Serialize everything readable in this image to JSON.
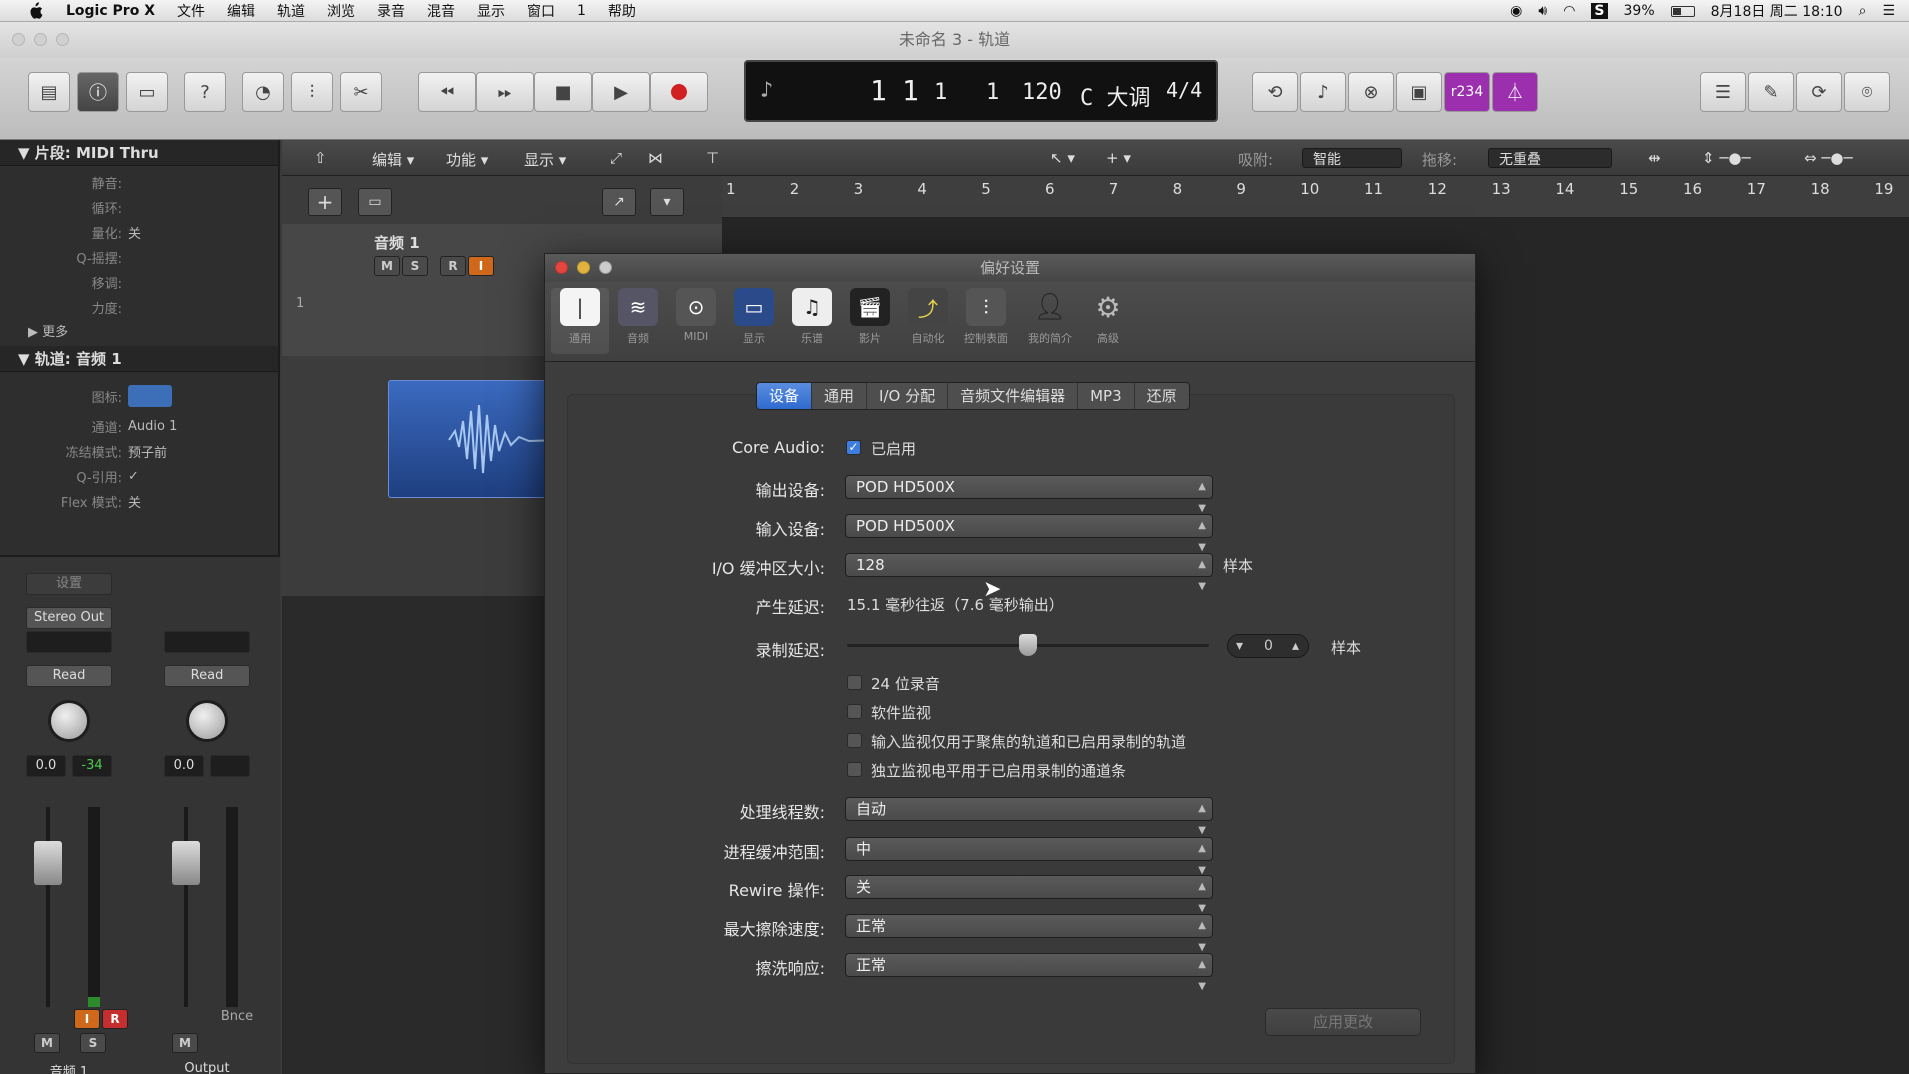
{
  "menubar": {
    "app_name": "Logic Pro X",
    "items": [
      "文件",
      "编辑",
      "轨道",
      "浏览",
      "录音",
      "混音",
      "显示",
      "窗口",
      "1",
      "帮助"
    ],
    "battery": "39%",
    "datetime": "8月18日 周二  18:10"
  },
  "window": {
    "title": "未命名 3 - 轨道"
  },
  "lcd": {
    "bar": "1",
    "beat": "1",
    "div": "1",
    "tick": "1",
    "tempo": "120",
    "key": "C 大调",
    "sig": "4/4"
  },
  "toolbar": {
    "counter_label": "r234"
  },
  "inspector": {
    "region_header": "片段: MIDI Thru",
    "region_rows": [
      {
        "label": "静音:",
        "value": ""
      },
      {
        "label": "循环:",
        "value": ""
      },
      {
        "label": "量化:",
        "value": "关"
      },
      {
        "label": "Q-摇摆:",
        "value": ""
      },
      {
        "label": "移调:",
        "value": ""
      },
      {
        "label": "力度:",
        "value": ""
      }
    ],
    "more": "更多",
    "track_header": "轨道: 音频 1",
    "track_rows": [
      {
        "label": "图标:",
        "value": ""
      },
      {
        "label": "通道:",
        "value": "Audio 1"
      },
      {
        "label": "冻结模式:",
        "value": "预子前"
      },
      {
        "label": "Q-引用:",
        "value": "✓"
      },
      {
        "label": "Flex 模式:",
        "value": "关"
      }
    ]
  },
  "strips": [
    {
      "name": "音频 1",
      "output": "Stereo Out",
      "automation": "Read",
      "vol": "0.0",
      "peak": "-34",
      "top_label": "设置"
    },
    {
      "name": "Output",
      "output": "",
      "automation": "Read",
      "vol": "0.0",
      "peak": "",
      "bottom_label": "Bnce"
    }
  ],
  "strip_buttons": {
    "m": "M",
    "s": "S",
    "i": "I",
    "r": "R"
  },
  "tracks_header": {
    "edit": "编辑",
    "func": "功能",
    "view": "显示",
    "snap_label": "吸附:",
    "snap_value": "智能",
    "drag_label": "拖移:",
    "drag_value": "无重叠"
  },
  "ruler": [
    "1",
    "2",
    "3",
    "4",
    "5",
    "6",
    "7",
    "8",
    "9",
    "10",
    "11",
    "12",
    "13",
    "14",
    "15",
    "16",
    "17",
    "18",
    "19"
  ],
  "track": {
    "name": "音频 1",
    "number": "1",
    "m": "M",
    "s": "S",
    "r": "R",
    "i": "I"
  },
  "dialog": {
    "title": "偏好设置",
    "pref_icons": [
      "通用",
      "音频",
      "MIDI",
      "显示",
      "乐谱",
      "影片",
      "自动化",
      "控制表面",
      "我的简介",
      "高级"
    ],
    "tabs": [
      "设备",
      "通用",
      "I/O 分配",
      "音频文件编辑器",
      "MP3",
      "还原"
    ],
    "core_audio_label": "Core Audio:",
    "core_audio_value": "已启用",
    "output_label": "输出设备:",
    "output_value": "POD HD500X",
    "input_label": "输入设备:",
    "input_value": "POD HD500X",
    "buffer_label": "I/O 缓冲区大小:",
    "buffer_value": "128",
    "buffer_unit": "样本",
    "latency_label": "产生延迟:",
    "latency_value": "15.1 毫秒往返（7.6 毫秒输出）",
    "rec_delay_label": "录制延迟:",
    "rec_delay_value": "0",
    "rec_delay_unit": "样本",
    "checkboxes": [
      "24 位录音",
      "软件监视",
      "输入监视仅用于聚焦的轨道和已启用录制的轨道",
      "独立监视电平用于已启用录制的通道条"
    ],
    "threads_label": "处理线程数:",
    "threads_value": "自动",
    "process_buffer_label": "进程缓冲范围:",
    "process_buffer_value": "中",
    "rewire_label": "Rewire 操作:",
    "rewire_value": "关",
    "scrub_label": "最大擦除速度:",
    "scrub_value": "正常",
    "scrub_resp_label": "擦洗响应:",
    "scrub_resp_value": "正常",
    "apply_button": "应用更改"
  },
  "colors": {
    "accent": "#3d7de0",
    "purple_btn": "#9b2fae",
    "record": "#d12020"
  }
}
